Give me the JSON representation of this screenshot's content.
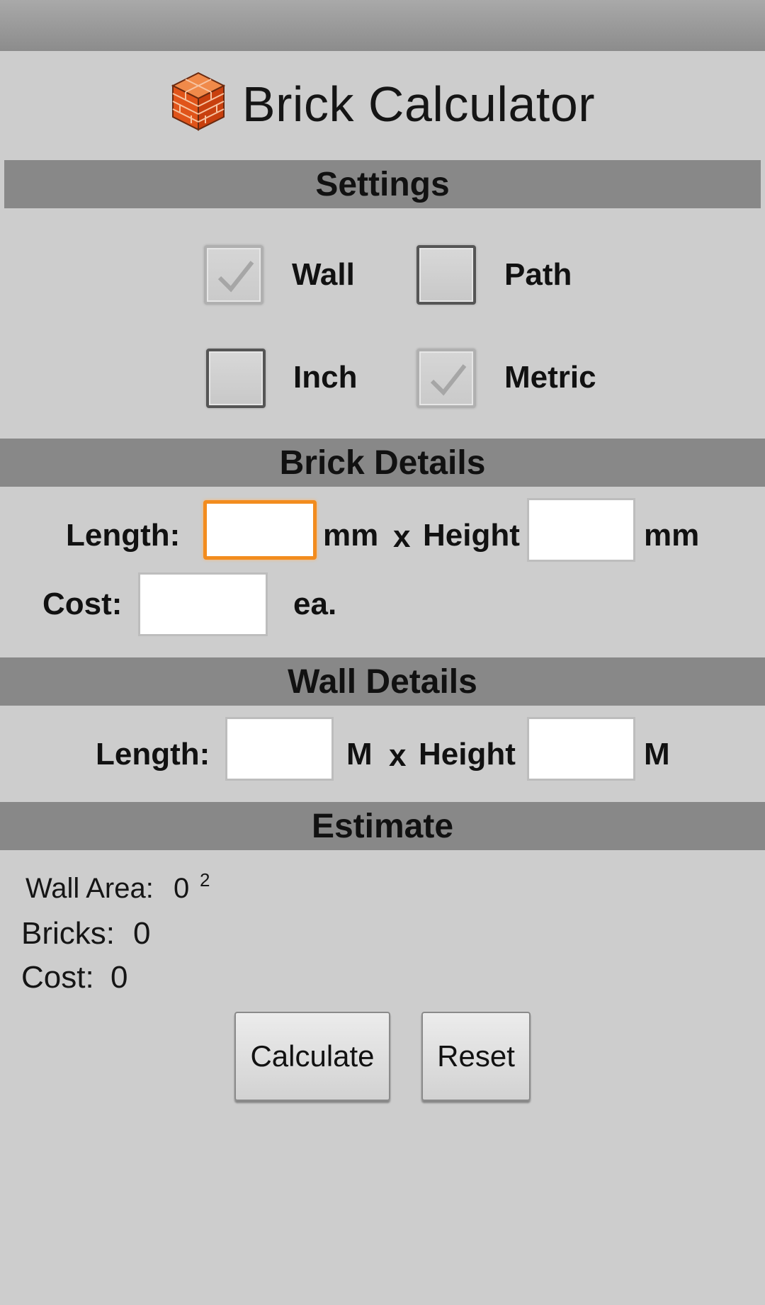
{
  "app": {
    "title": "Brick Calculator",
    "icon": "brick-cube-icon",
    "accent_color": "#f28c1e",
    "header_bar_color": "#888888",
    "background_color": "#cdcdcd"
  },
  "settings": {
    "header": "Settings",
    "options": [
      {
        "label": "Wall",
        "checked": true
      },
      {
        "label": "Path",
        "checked": false
      },
      {
        "label": "Inch",
        "checked": false
      },
      {
        "label": "Metric",
        "checked": true
      }
    ]
  },
  "brick_details": {
    "header": "Brick Details",
    "length_label": "Length:",
    "length_value": "",
    "length_unit": "mm",
    "times": "x",
    "height_label": "Height",
    "height_value": "",
    "height_unit": "mm",
    "cost_label": "Cost:",
    "cost_value": "",
    "cost_unit": "ea."
  },
  "wall_details": {
    "header": "Wall Details",
    "length_label": "Length:",
    "length_value": "",
    "length_unit": "M",
    "times": "x",
    "height_label": "Height",
    "height_value": "",
    "height_unit": "M"
  },
  "estimate": {
    "header": "Estimate",
    "wall_area_label": "Wall Area:",
    "wall_area_value": "0",
    "wall_area_sup": "2",
    "bricks_label": "Bricks:",
    "bricks_value": "0",
    "cost_label": "Cost:",
    "cost_value": "0"
  },
  "buttons": {
    "calculate": "Calculate",
    "reset": "Reset"
  }
}
